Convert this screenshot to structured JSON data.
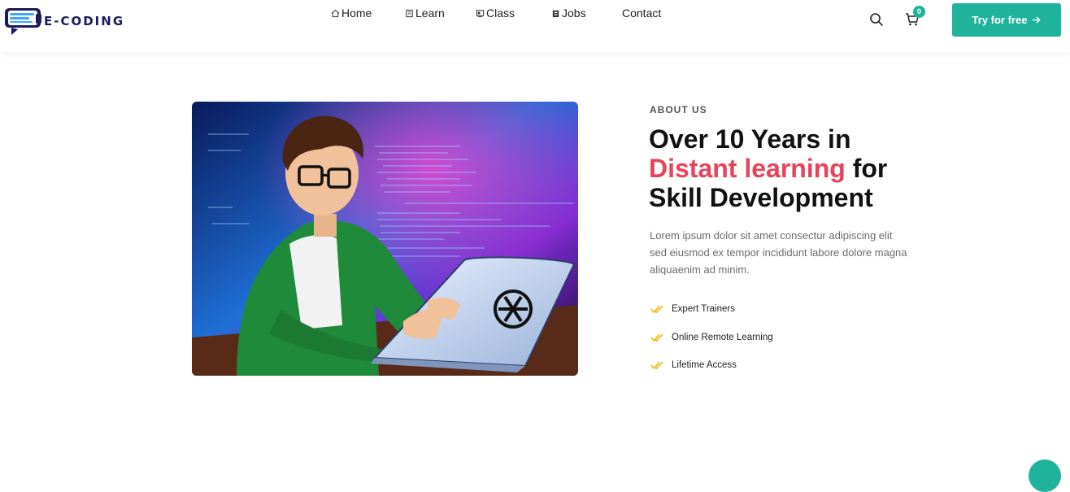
{
  "brand": {
    "name": "E-CODING"
  },
  "nav": {
    "items": [
      {
        "label": "Home",
        "icon": "home-icon"
      },
      {
        "label": "Learn",
        "icon": "book-icon"
      },
      {
        "label": "Class",
        "icon": "class-icon"
      },
      {
        "label": "Jobs",
        "icon": "jobs-icon"
      },
      {
        "label": "Contact"
      }
    ]
  },
  "header_actions": {
    "search_icon": "search-icon",
    "cart_icon": "cart-icon",
    "cart_count": "0",
    "cta_label": "Try for free",
    "cta_icon": "arrow-right-icon"
  },
  "about": {
    "label": "ABOUT US",
    "headline_line1": "Over 10 Years in",
    "headline_accent": "Distant learning",
    "headline_after_accent": " for",
    "headline_line3": "Skill Development",
    "description": "Lorem ipsum dolor sit amet consectur adipiscing elit sed eiusmod ex tempor incididunt labore dolore magna aliquaenim ad minim.",
    "features": [
      "Expert Trainers",
      "Online Remote Learning",
      "Lifetime Access"
    ]
  },
  "colors": {
    "accent": "#20b39b",
    "highlight": "#e8435d",
    "brand": "#1c1a5e",
    "check": "#f2b705"
  }
}
